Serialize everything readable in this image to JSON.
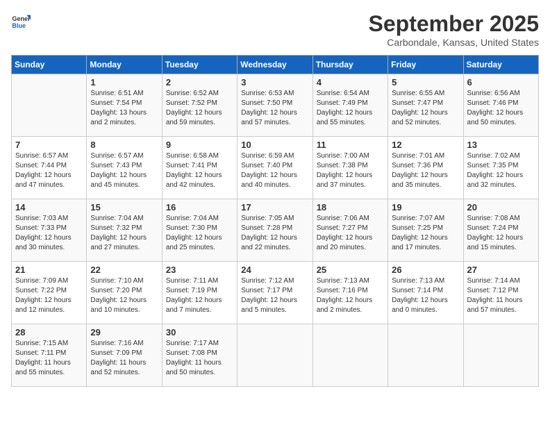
{
  "header": {
    "logo_line1": "General",
    "logo_line2": "Blue",
    "month": "September 2025",
    "location": "Carbondale, Kansas, United States"
  },
  "weekdays": [
    "Sunday",
    "Monday",
    "Tuesday",
    "Wednesday",
    "Thursday",
    "Friday",
    "Saturday"
  ],
  "weeks": [
    [
      {
        "day": "",
        "info": ""
      },
      {
        "day": "1",
        "info": "Sunrise: 6:51 AM\nSunset: 7:54 PM\nDaylight: 13 hours\nand 2 minutes."
      },
      {
        "day": "2",
        "info": "Sunrise: 6:52 AM\nSunset: 7:52 PM\nDaylight: 12 hours\nand 59 minutes."
      },
      {
        "day": "3",
        "info": "Sunrise: 6:53 AM\nSunset: 7:50 PM\nDaylight: 12 hours\nand 57 minutes."
      },
      {
        "day": "4",
        "info": "Sunrise: 6:54 AM\nSunset: 7:49 PM\nDaylight: 12 hours\nand 55 minutes."
      },
      {
        "day": "5",
        "info": "Sunrise: 6:55 AM\nSunset: 7:47 PM\nDaylight: 12 hours\nand 52 minutes."
      },
      {
        "day": "6",
        "info": "Sunrise: 6:56 AM\nSunset: 7:46 PM\nDaylight: 12 hours\nand 50 minutes."
      }
    ],
    [
      {
        "day": "7",
        "info": "Sunrise: 6:57 AM\nSunset: 7:44 PM\nDaylight: 12 hours\nand 47 minutes."
      },
      {
        "day": "8",
        "info": "Sunrise: 6:57 AM\nSunset: 7:43 PM\nDaylight: 12 hours\nand 45 minutes."
      },
      {
        "day": "9",
        "info": "Sunrise: 6:58 AM\nSunset: 7:41 PM\nDaylight: 12 hours\nand 42 minutes."
      },
      {
        "day": "10",
        "info": "Sunrise: 6:59 AM\nSunset: 7:40 PM\nDaylight: 12 hours\nand 40 minutes."
      },
      {
        "day": "11",
        "info": "Sunrise: 7:00 AM\nSunset: 7:38 PM\nDaylight: 12 hours\nand 37 minutes."
      },
      {
        "day": "12",
        "info": "Sunrise: 7:01 AM\nSunset: 7:36 PM\nDaylight: 12 hours\nand 35 minutes."
      },
      {
        "day": "13",
        "info": "Sunrise: 7:02 AM\nSunset: 7:35 PM\nDaylight: 12 hours\nand 32 minutes."
      }
    ],
    [
      {
        "day": "14",
        "info": "Sunrise: 7:03 AM\nSunset: 7:33 PM\nDaylight: 12 hours\nand 30 minutes."
      },
      {
        "day": "15",
        "info": "Sunrise: 7:04 AM\nSunset: 7:32 PM\nDaylight: 12 hours\nand 27 minutes."
      },
      {
        "day": "16",
        "info": "Sunrise: 7:04 AM\nSunset: 7:30 PM\nDaylight: 12 hours\nand 25 minutes."
      },
      {
        "day": "17",
        "info": "Sunrise: 7:05 AM\nSunset: 7:28 PM\nDaylight: 12 hours\nand 22 minutes."
      },
      {
        "day": "18",
        "info": "Sunrise: 7:06 AM\nSunset: 7:27 PM\nDaylight: 12 hours\nand 20 minutes."
      },
      {
        "day": "19",
        "info": "Sunrise: 7:07 AM\nSunset: 7:25 PM\nDaylight: 12 hours\nand 17 minutes."
      },
      {
        "day": "20",
        "info": "Sunrise: 7:08 AM\nSunset: 7:24 PM\nDaylight: 12 hours\nand 15 minutes."
      }
    ],
    [
      {
        "day": "21",
        "info": "Sunrise: 7:09 AM\nSunset: 7:22 PM\nDaylight: 12 hours\nand 12 minutes."
      },
      {
        "day": "22",
        "info": "Sunrise: 7:10 AM\nSunset: 7:20 PM\nDaylight: 12 hours\nand 10 minutes."
      },
      {
        "day": "23",
        "info": "Sunrise: 7:11 AM\nSunset: 7:19 PM\nDaylight: 12 hours\nand 7 minutes."
      },
      {
        "day": "24",
        "info": "Sunrise: 7:12 AM\nSunset: 7:17 PM\nDaylight: 12 hours\nand 5 minutes."
      },
      {
        "day": "25",
        "info": "Sunrise: 7:13 AM\nSunset: 7:16 PM\nDaylight: 12 hours\nand 2 minutes."
      },
      {
        "day": "26",
        "info": "Sunrise: 7:13 AM\nSunset: 7:14 PM\nDaylight: 12 hours\nand 0 minutes."
      },
      {
        "day": "27",
        "info": "Sunrise: 7:14 AM\nSunset: 7:12 PM\nDaylight: 11 hours\nand 57 minutes."
      }
    ],
    [
      {
        "day": "28",
        "info": "Sunrise: 7:15 AM\nSunset: 7:11 PM\nDaylight: 11 hours\nand 55 minutes."
      },
      {
        "day": "29",
        "info": "Sunrise: 7:16 AM\nSunset: 7:09 PM\nDaylight: 11 hours\nand 52 minutes."
      },
      {
        "day": "30",
        "info": "Sunrise: 7:17 AM\nSunset: 7:08 PM\nDaylight: 11 hours\nand 50 minutes."
      },
      {
        "day": "",
        "info": ""
      },
      {
        "day": "",
        "info": ""
      },
      {
        "day": "",
        "info": ""
      },
      {
        "day": "",
        "info": ""
      }
    ]
  ]
}
